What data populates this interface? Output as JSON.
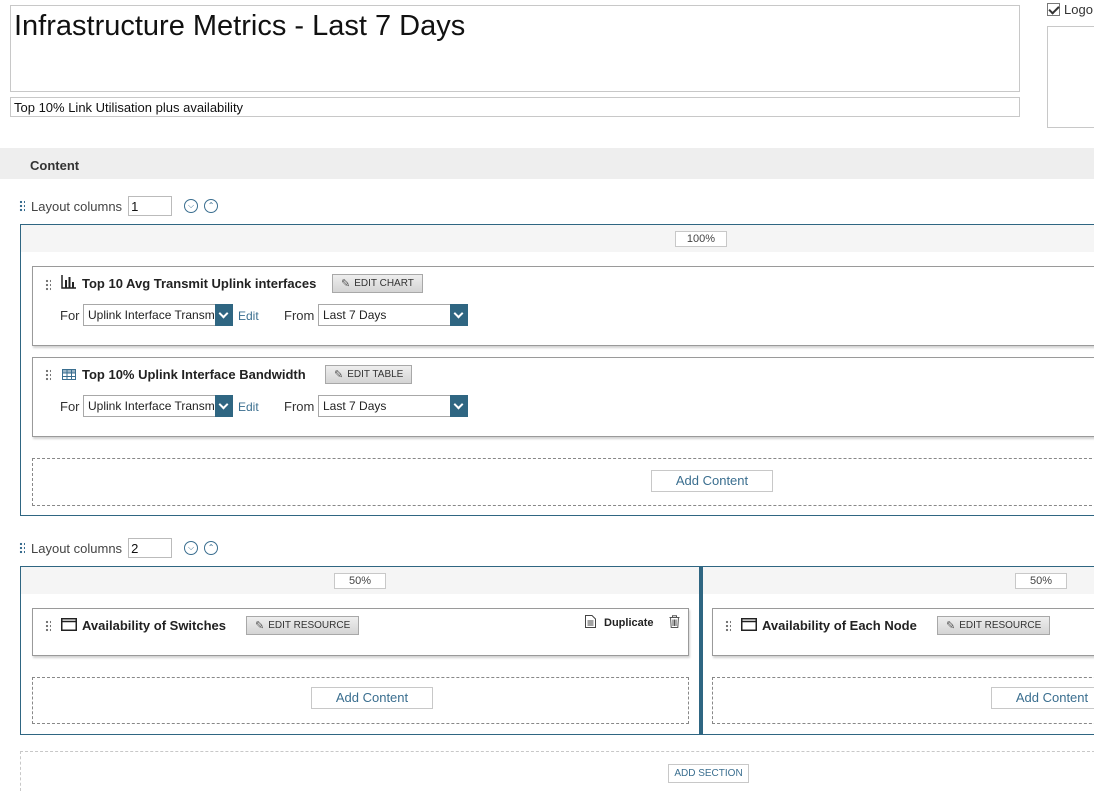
{
  "header": {
    "title": "Infrastructure Metrics - Last 7 Days",
    "subtitle": "Top 10% Link Utilisation plus availability",
    "logo_label": "Logo"
  },
  "content_section_label": "Content",
  "sections": [
    {
      "layout_label": "Layout columns",
      "layout_value": "1",
      "columns": [
        {
          "width_label": "100%",
          "items": [
            {
              "title": "Top 10 Avg Transmit Uplink interfaces",
              "icon": "bar-chart-icon",
              "edit_label": "EDIT CHART",
              "for_label": "For",
              "for_value": "Uplink Interface Transmit",
              "edit_link": "Edit",
              "from_label": "From",
              "from_value": "Last 7 Days"
            },
            {
              "title": "Top 10% Uplink Interface Bandwidth",
              "icon": "table-icon",
              "edit_label": "EDIT TABLE",
              "for_label": "For",
              "for_value": "Uplink Interface Transmit",
              "edit_link": "Edit",
              "from_label": "From",
              "from_value": "Last 7 Days"
            }
          ],
          "add_content_label": "Add Content"
        }
      ]
    },
    {
      "layout_label": "Layout columns",
      "layout_value": "2",
      "columns": [
        {
          "width_label": "50%",
          "items": [
            {
              "title": "Availability of Switches",
              "icon": "resource-window-icon",
              "edit_label": "EDIT RESOURCE",
              "duplicate_label": "Duplicate"
            }
          ],
          "add_content_label": "Add Content"
        },
        {
          "width_label": "50%",
          "items": [
            {
              "title": "Availability of Each Node",
              "icon": "resource-window-icon",
              "edit_label": "EDIT RESOURCE"
            }
          ],
          "add_content_label": "Add Content"
        }
      ]
    }
  ],
  "add_section_label": "ADD SECTION",
  "colors": {
    "accent": "#2f6682",
    "link": "#3a6e8f",
    "band": "#eeeeee"
  }
}
